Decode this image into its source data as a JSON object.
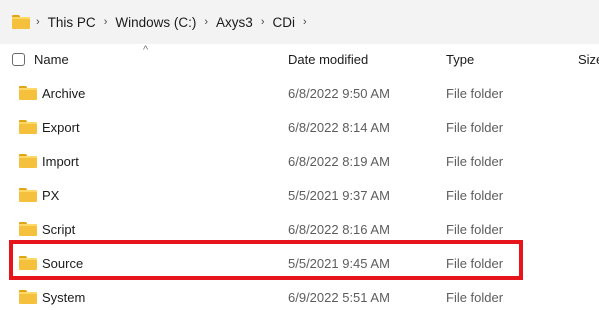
{
  "breadcrumb": [
    "This PC",
    "Windows (C:)",
    "Axys3",
    "CDi"
  ],
  "breadcrumb_separator": "›",
  "columns": {
    "name": "Name",
    "date": "Date modified",
    "type": "Type",
    "size": "Size"
  },
  "sort_caret": "^",
  "rows": [
    {
      "name": "Archive",
      "date": "6/8/2022 9:50 AM",
      "type": "File folder"
    },
    {
      "name": "Export",
      "date": "6/8/2022 8:14 AM",
      "type": "File folder"
    },
    {
      "name": "Import",
      "date": "6/8/2022 8:19 AM",
      "type": "File folder"
    },
    {
      "name": "PX",
      "date": "5/5/2021 9:37 AM",
      "type": "File folder"
    },
    {
      "name": "Script",
      "date": "6/8/2022 8:16 AM",
      "type": "File folder"
    },
    {
      "name": "Source",
      "date": "5/5/2021 9:45 AM",
      "type": "File folder"
    },
    {
      "name": "System",
      "date": "6/9/2022 5:51 AM",
      "type": "File folder"
    }
  ],
  "highlighted_row": "Source",
  "colors": {
    "highlight": "#e8141b",
    "folder": "#f5c13d"
  }
}
